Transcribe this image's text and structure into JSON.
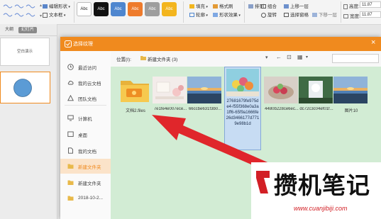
{
  "ribbon": {
    "edit_shape": "编辑形状",
    "text_box": "文本框",
    "swatches": [
      {
        "label": "Abc",
        "bg": "#ffffff",
        "fg": "#222222"
      },
      {
        "label": "Abc",
        "bg": "#111111",
        "fg": "#ffffff"
      },
      {
        "label": "Abc",
        "bg": "#4e86cf",
        "fg": "#ffffff"
      },
      {
        "label": "Abc",
        "bg": "#ee7b2c",
        "fg": "#ffffff"
      },
      {
        "label": "Abc",
        "bg": "#9e9e9e",
        "fg": "#ffffff"
      },
      {
        "label": "Abc",
        "bg": "#f3b51e",
        "fg": "#ffffff"
      }
    ],
    "fill": "填充",
    "format_painter": "格式刷",
    "outline": "轮廓",
    "shape_effects": "形状效果",
    "arrange": "排列",
    "combine": "组合",
    "rotate": "旋转",
    "select_pane": "选择窗格",
    "move_up": "上移一层",
    "move_down": "下移一层",
    "height_label": "高度:",
    "height_value": "11.87",
    "width_label": "宽度:",
    "width_value": "11.87"
  },
  "leftpanel": {
    "tab_outline": "大纲",
    "tab_slides": "幻灯片",
    "slide1_text": "空白演示"
  },
  "dialog": {
    "title": "选择纹理",
    "close": "×",
    "sidebar": [
      {
        "label": "最近访问",
        "icon": "clock-icon"
      },
      {
        "label": "我的云文档",
        "icon": "cloud-icon"
      },
      {
        "label": "团队文档",
        "icon": "team-icon"
      },
      {
        "label": "计算机",
        "icon": "computer-icon"
      },
      {
        "label": "桌面",
        "icon": "desktop-icon"
      },
      {
        "label": "我的文档",
        "icon": "document-icon"
      },
      {
        "label": "新建文件夹",
        "icon": "folder-icon"
      },
      {
        "label": "新建文件夹",
        "icon": "folder-icon"
      },
      {
        "label": "2018-10-2...",
        "icon": "folder-icon"
      }
    ],
    "location_label": "位置(I):",
    "location_value": "新建文件夹 (3)",
    "search_placeholder": "",
    "files": [
      {
        "name": "文档2.files",
        "kind": "folder"
      },
      {
        "name": "7e1fe4e007ece...",
        "kind": "image"
      },
      {
        "name": "66ccbe631f3b0...",
        "kind": "image"
      },
      {
        "name": "27681679fe975de4-f55f368e0a3a1ff6-65f9a1666fe26d3466177d7719e98b1d",
        "kind": "image",
        "selected": true
      },
      {
        "name": "4480b228ce6ec...",
        "kind": "image"
      },
      {
        "name": "dc72c3c04ef01f...",
        "kind": "image"
      },
      {
        "name": "图片10",
        "kind": "image"
      }
    ],
    "selected_name_lines": [
      "27681679fe975d",
      "e4-f55f368e0a3a",
      "1ff6-65f9a1666fe",
      "26d3466177d771",
      "9e98b1d"
    ]
  },
  "watermark": {
    "text": "攒机笔记",
    "url": "www.cuanjibiji.com"
  },
  "colors": {
    "accent": "#f08a1e",
    "content_bg": "#d2ecd4",
    "arrow": "#e0262b"
  }
}
